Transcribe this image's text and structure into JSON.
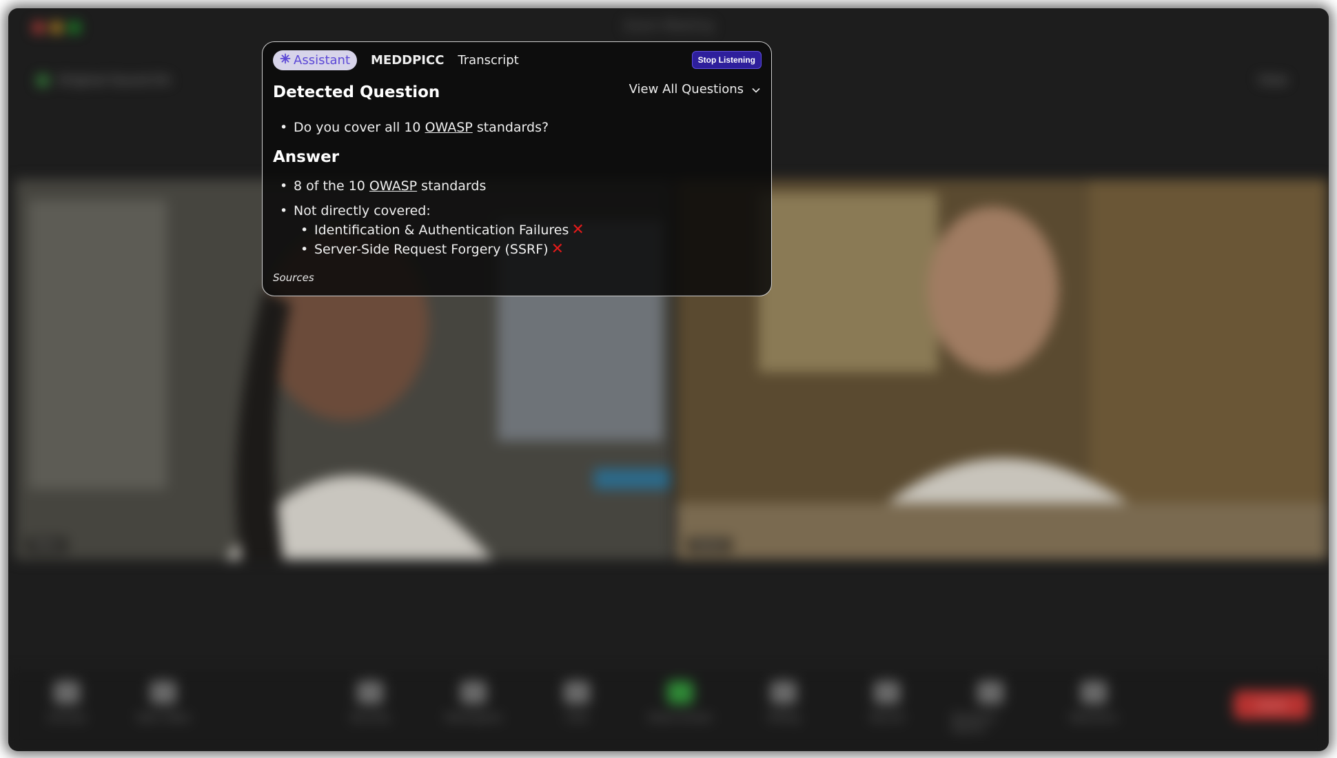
{
  "meeting_window": {
    "title": "Zoom Meeting",
    "call_label": "Original Sound On",
    "view_label": "View",
    "participants": [
      {
        "name": "Maria"
      },
      {
        "name": "Daniel"
      }
    ],
    "toolbar": [
      {
        "label": "Unmute",
        "icon": "microphone-icon"
      },
      {
        "label": "Start Video",
        "icon": "video-camera-icon"
      },
      {
        "label": "Security",
        "icon": "shield-icon"
      },
      {
        "label": "Participants",
        "icon": "participants-icon"
      },
      {
        "label": "Chat",
        "icon": "chat-icon"
      },
      {
        "label": "Share Screen",
        "icon": "share-screen-icon"
      },
      {
        "label": "Polling",
        "icon": "polling-icon"
      },
      {
        "label": "Record",
        "icon": "record-icon"
      },
      {
        "label": "Breakout Rooms",
        "icon": "breakout-rooms-icon"
      },
      {
        "label": "Reactions",
        "icon": "reactions-icon"
      }
    ],
    "end_label": "Leave"
  },
  "assistant": {
    "tabs": [
      {
        "label": "Assistant",
        "icon": "sparkle-icon",
        "active": true
      },
      {
        "label": "MEDDPICC",
        "active": false
      },
      {
        "label": "Transcript",
        "active": false
      }
    ],
    "stop_button": "Stop Listening",
    "detected_question_heading": "Detected Question",
    "view_all": "View All Questions",
    "question": {
      "before": "Do you cover all 10 ",
      "link": "OWASP",
      "after": " standards?"
    },
    "answer_heading": "Answer",
    "answer": {
      "line1_before": "8 of the 10 ",
      "line1_link": "OWASP",
      "line1_after": " standards",
      "line2": "Not directly covered:",
      "sub_items": [
        "Identification & Authentication Failures",
        "Server-Side Request Forgery (SSRF)"
      ],
      "status_mark": "✕"
    },
    "sources_label": "Sources",
    "colors": {
      "accent": "#5b47d6",
      "stop_button_bg": "#2e1f9c",
      "x_mark": "#e31a1a"
    }
  }
}
